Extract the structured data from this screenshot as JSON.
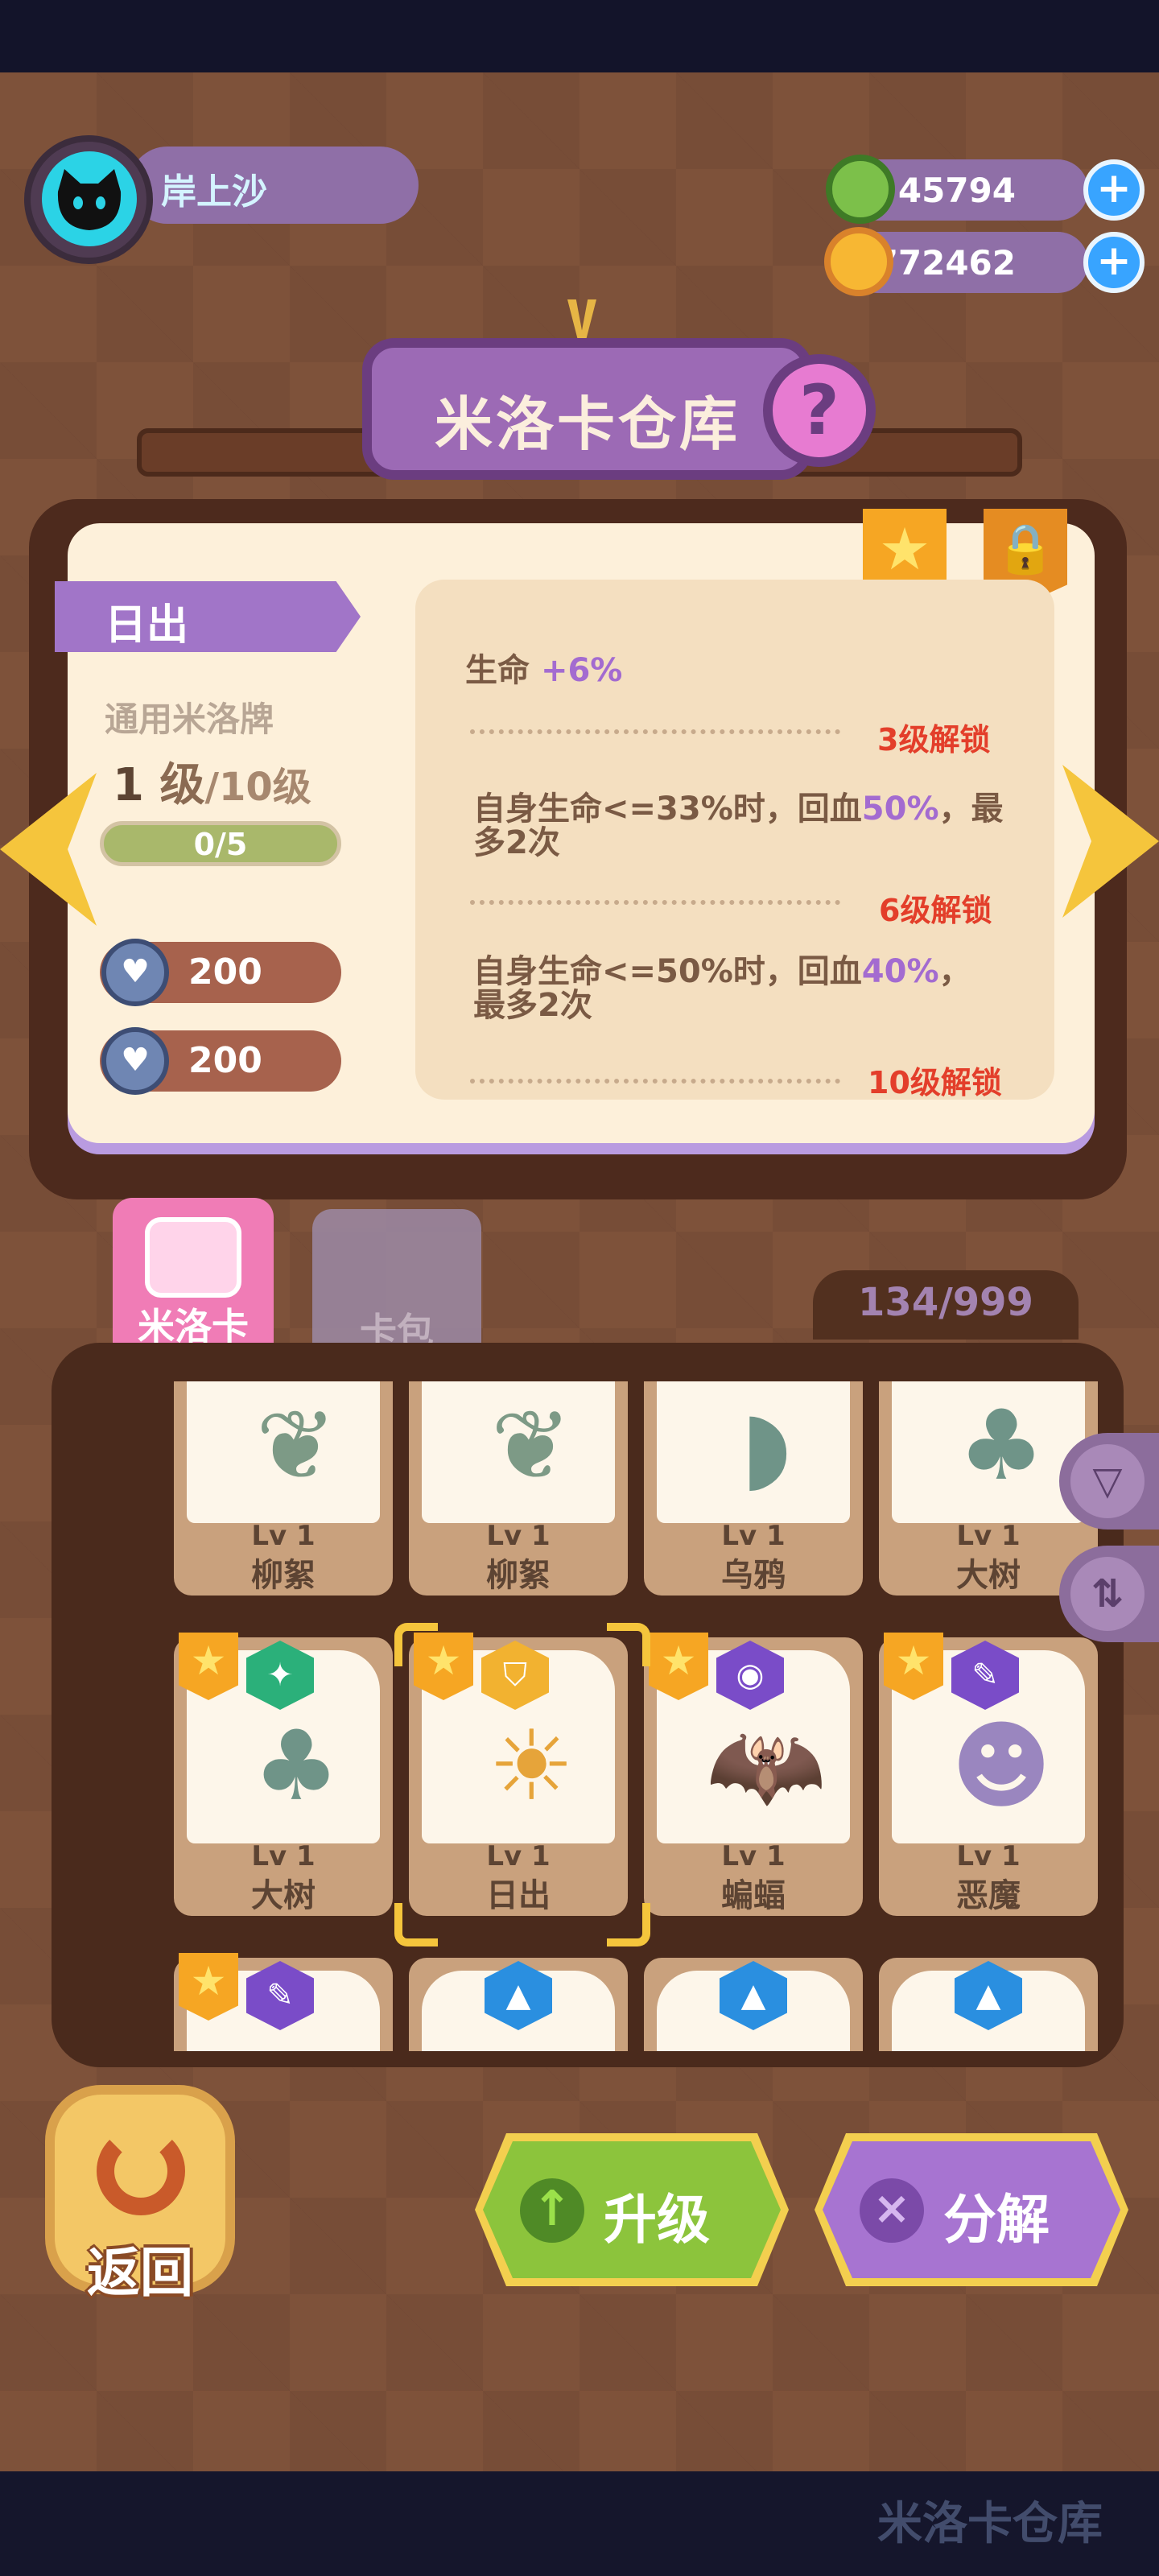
{
  "profile": {
    "name": "岸上沙"
  },
  "currency": {
    "gems": "45794",
    "coins": "73772462",
    "plus": "+"
  },
  "title": {
    "text": "米洛卡仓库",
    "help": "?"
  },
  "detail": {
    "card_name": "日出",
    "card_type": "通用米洛牌",
    "level": "1",
    "level_unit": "级",
    "level_max": "/10级",
    "progress": "0/5",
    "stats": [
      "200",
      "200"
    ],
    "effects": [
      {
        "text": "生命",
        "value": "+6%"
      },
      {
        "text_a": "自身生命<=33%时，回血",
        "value": "50%",
        "text_b": "，最",
        "text_c": "多2次",
        "unlock": "3级解锁"
      },
      {
        "text_a": "自身生命<=50%时，回血",
        "value": "40%",
        "text_b": "，",
        "text_c": "最多2次",
        "unlock": "6级解锁"
      },
      {
        "unlock": "10级解锁"
      }
    ]
  },
  "tabs": {
    "card": "米洛卡",
    "pack": "卡包"
  },
  "inventory": {
    "count": "134/999",
    "rows": [
      [
        {
          "lv": "Lv 1",
          "name": "柳絮"
        },
        {
          "lv": "Lv 1",
          "name": "柳絮"
        },
        {
          "lv": "Lv 1",
          "name": "乌鸦"
        },
        {
          "lv": "Lv 1",
          "name": "大树"
        }
      ],
      [
        {
          "lv": "Lv 1",
          "name": "大树"
        },
        {
          "lv": "Lv 1",
          "name": "日出"
        },
        {
          "lv": "Lv 1",
          "name": "蝙蝠"
        },
        {
          "lv": "Lv 1",
          "name": "恶魔"
        }
      ]
    ]
  },
  "buttons": {
    "back": "返回",
    "upgrade": "升级",
    "decompose": "分解"
  },
  "footer": {
    "label": "米洛卡仓库"
  },
  "colors": {
    "accent_purple": "#a175c8",
    "upgrade_green": "#8cc43c",
    "unlock_red": "#e33e2a"
  }
}
